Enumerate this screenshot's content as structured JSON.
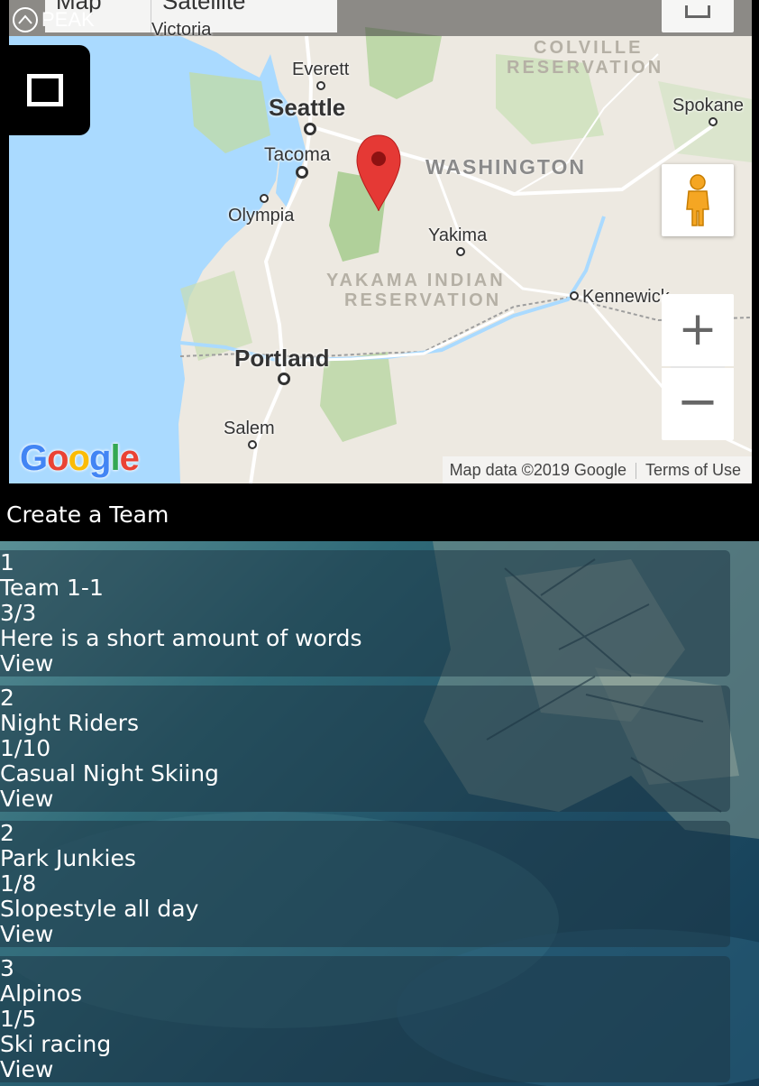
{
  "brand": {
    "name": "PEAK"
  },
  "map": {
    "type_controls": {
      "map_label": "Map",
      "satellite_label": "Satellite"
    },
    "cities": {
      "victoria": "Victoria",
      "everett": "Everett",
      "seattle": "Seattle",
      "tacoma": "Tacoma",
      "olympia": "Olympia",
      "yakima": "Yakima",
      "kennewick": "Kennewick",
      "portland": "Portland",
      "salem": "Salem",
      "spokane": "Spokane"
    },
    "regions": {
      "washington": "WASHINGTON",
      "colville_1": "COLVILLE",
      "colville_2": "RESERVATION",
      "yakama_1": "YAKAMA INDIAN",
      "yakama_2": "RESERVATION"
    },
    "zoom_in": "+",
    "zoom_out": "−",
    "attribution": {
      "data": "Map data ©2019 Google",
      "terms": "Terms of Use"
    },
    "logo": "Google"
  },
  "create_team_label": "Create a Team",
  "teams": [
    {
      "number": "1",
      "name": "Team 1-1",
      "members": "3/3",
      "description": "Here is a short amount of words",
      "action": "View"
    },
    {
      "number": "2",
      "name": "Night Riders",
      "members": "1/10",
      "description": "Casual Night Skiing",
      "action": "View"
    },
    {
      "number": "2",
      "name": "Park Junkies",
      "members": "1/8",
      "description": "Slopestyle all day",
      "action": "View"
    },
    {
      "number": "3",
      "name": "Alpinos",
      "members": "1/5",
      "description": "Ski racing",
      "action": "View"
    }
  ]
}
